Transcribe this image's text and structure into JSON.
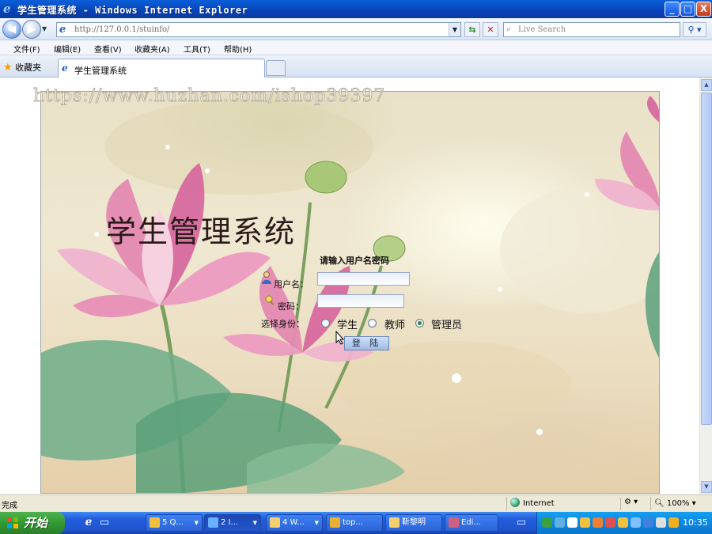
{
  "window": {
    "title": "学生管理系统 - Windows Internet Explorer",
    "buttons": {
      "minimize": "_",
      "maximize": "□",
      "close": "X"
    }
  },
  "address_bar": {
    "url": "http://127.0.0.1/stuinfo/",
    "search_placeholder": "Live Search"
  },
  "menu": {
    "items": [
      "文件(F)",
      "编辑(E)",
      "查看(V)",
      "收藏夹(A)",
      "工具(T)",
      "帮助(H)"
    ]
  },
  "tabs": {
    "favorites_label": "收藏夹",
    "active_tab": "学生管理系统"
  },
  "page": {
    "watermark": "https://www.huzhan.com/ishop39397",
    "system_title": "学生管理系统",
    "login_prompt": "请输入用户名密码",
    "username_label": "用户名：",
    "password_label": "密码：",
    "role_label": "选择身份：",
    "roles": [
      {
        "label": "学生",
        "selected": false
      },
      {
        "label": "教师",
        "selected": false
      },
      {
        "label": "管理员",
        "selected": true
      }
    ],
    "username_value": "",
    "password_value": "",
    "login_button": "登 陆"
  },
  "status_bar": {
    "status": "完成",
    "zone": "Internet",
    "zoom": "100%"
  },
  "taskbar": {
    "start_label": "开始",
    "buttons": [
      {
        "label": "5 Q...",
        "active": false
      },
      {
        "label": "2 I...",
        "active": true
      },
      {
        "label": "4 W...",
        "active": false
      },
      {
        "label": "top...",
        "active": false
      },
      {
        "label": "靳黎明",
        "active": false
      },
      {
        "label": "Edi...",
        "active": false
      }
    ],
    "clock": "10:35"
  },
  "colors": {
    "title_bar": "#0842b8",
    "taskbar": "#245edc",
    "start_button": "#339933",
    "lotus_pink": "#e07aa8",
    "leaf_green": "#5aa07a"
  }
}
